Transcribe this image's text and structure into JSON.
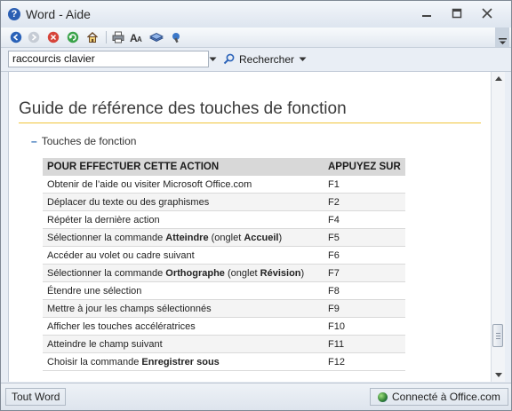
{
  "window": {
    "title": "Word - Aide"
  },
  "toolbar": {
    "buttons": [
      {
        "name": "back-icon",
        "label": ""
      },
      {
        "name": "forward-icon",
        "label": ""
      },
      {
        "name": "stop-icon",
        "label": ""
      },
      {
        "name": "refresh-icon",
        "label": ""
      },
      {
        "name": "home-icon",
        "label": ""
      },
      {
        "name": "print-icon",
        "label": ""
      },
      {
        "name": "font-size-icon",
        "label": ""
      },
      {
        "name": "table-of-contents-icon",
        "label": ""
      },
      {
        "name": "keep-on-top-icon",
        "label": ""
      }
    ]
  },
  "search": {
    "value": "raccourcis clavier",
    "button_label": "Rechercher"
  },
  "page": {
    "title": "Guide de référence des touches de fonction",
    "section_toggle": "–",
    "section_label": "Touches de fonction"
  },
  "table": {
    "headers": [
      "POUR EFFECTUER CETTE ACTION",
      "APPUYEZ SUR"
    ],
    "rows": [
      {
        "action": "Obtenir de l’aide ou visiter Microsoft Office.com",
        "key": "F1"
      },
      {
        "action": "Déplacer du texte ou des graphismes",
        "key": "F2"
      },
      {
        "action": "Répéter la dernière action",
        "key": "F4"
      },
      {
        "action_parts": [
          "Sélectionner la commande ",
          "Atteindre",
          " (onglet ",
          "Accueil",
          ")"
        ],
        "action": "Sélectionner la commande Atteindre (onglet Accueil)",
        "key": "F5"
      },
      {
        "action": "Accéder au volet ou cadre suivant",
        "key": "F6"
      },
      {
        "action_parts": [
          "Sélectionner la commande ",
          "Orthographe",
          " (onglet ",
          "Révision",
          ")"
        ],
        "action": "Sélectionner la commande Orthographe (onglet Révision)",
        "key": "F7"
      },
      {
        "action": "Étendre une sélection",
        "key": "F8"
      },
      {
        "action": "Mettre à jour les champs sélectionnés",
        "key": "F9"
      },
      {
        "action": "Afficher les touches accélératrices",
        "key": "F10"
      },
      {
        "action": "Atteindre le champ suivant",
        "key": "F11"
      },
      {
        "action_parts": [
          "Choisir la commande ",
          "Enregistrer sous",
          "",
          "",
          ""
        ],
        "action": "Choisir la commande Enregistrer sous",
        "key": "F12"
      }
    ]
  },
  "status": {
    "left": "Tout Word",
    "right": "Connecté à Office.com"
  },
  "colors": {
    "accent_rule": "#f0c43a",
    "header_bg": "#d8d8d8",
    "link_blue": "#2f6db5"
  }
}
